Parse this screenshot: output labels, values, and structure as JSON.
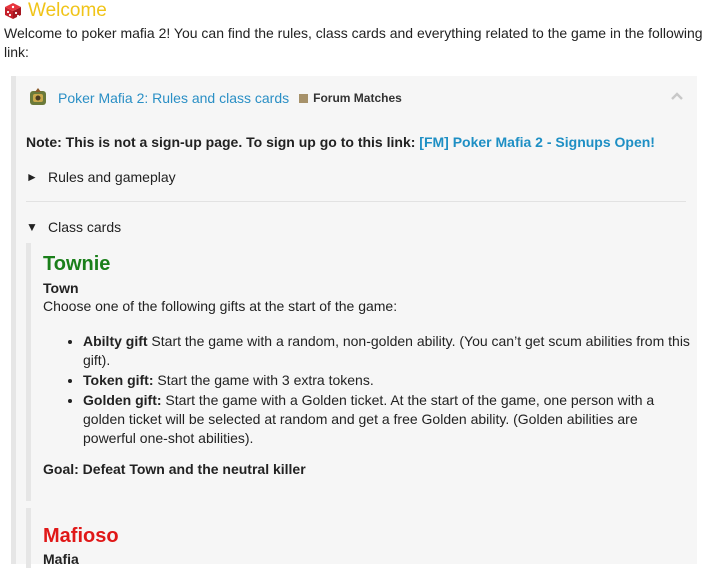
{
  "page": {
    "welcome_title": "Welcome",
    "intro_text": "Welcome to poker mafia 2! You can find the rules, class cards and everything related to the game in the following link:"
  },
  "onebox": {
    "topic_title": "Poker Mafia 2: Rules and class cards",
    "category": "Forum Matches",
    "category_color": "#a7926a",
    "note_prefix": "Note: This is not a sign-up page. To sign up go to this link:",
    "note_link": "[FM] Poker Mafia 2 - Signups Open!",
    "sections": [
      {
        "label": "Rules and gameplay",
        "expanded": false
      },
      {
        "label": "Class cards",
        "expanded": true
      }
    ],
    "cards": [
      {
        "name": "Townie",
        "color": "#1a7f1a",
        "faction": "Town",
        "intro": "Choose one of the following gifts at the start of the game:",
        "gifts": [
          {
            "name": "Abilty gift",
            "text": " Start the game with a random, non-golden ability. (You can’t get scum abilities from this gift)."
          },
          {
            "name": "Token gift:",
            "text": " Start the game with 3 extra tokens."
          },
          {
            "name": "Golden gift:",
            "text": " Start the game with a Golden ticket. At the start of the game, one person with a golden ticket will be selected at random and get a free Golden ability. (Golden abilities are powerful one-shot abilities)."
          }
        ],
        "goal": "Goal: Defeat Town and the neutral killer"
      },
      {
        "name": "Mafioso",
        "color": "#e01818",
        "faction": "Mafia"
      }
    ]
  },
  "colors": {
    "link": "#2a8fc5",
    "welcome": "#f0c419"
  }
}
